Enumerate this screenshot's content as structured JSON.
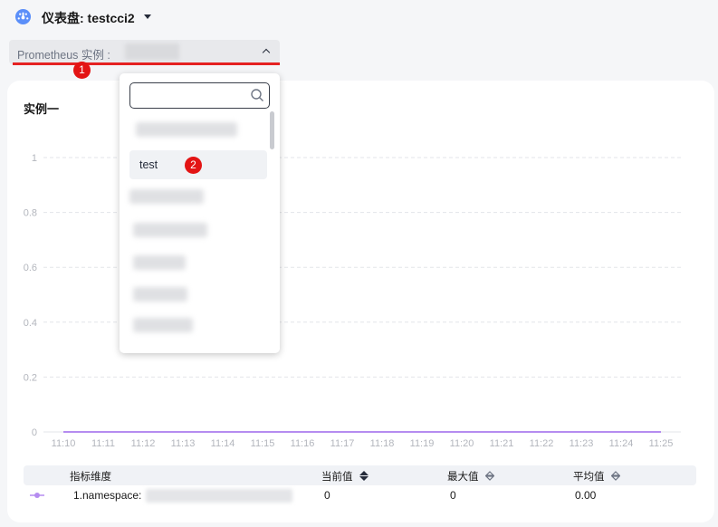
{
  "header": {
    "title": "仪表盘: testcci2"
  },
  "instance_select": {
    "label": "Prometheus 实例 :",
    "marker": "1"
  },
  "card": {
    "title": "实例一"
  },
  "dropdown": {
    "search_placeholder": "",
    "options": [
      {
        "label": "",
        "redacted": true
      },
      {
        "label": "test",
        "redacted": false,
        "marker": "2"
      },
      {
        "label": "",
        "redacted": true
      },
      {
        "label": "",
        "redacted": true
      },
      {
        "label": "",
        "redacted": true
      },
      {
        "label": "",
        "redacted": true
      },
      {
        "label": "",
        "redacted": true
      }
    ]
  },
  "chart_data": {
    "type": "line",
    "x": [
      "11:10",
      "11:11",
      "11:12",
      "11:13",
      "11:14",
      "11:15",
      "11:16",
      "11:17",
      "11:18",
      "11:19",
      "11:20",
      "11:21",
      "11:22",
      "11:23",
      "11:24",
      "11:25"
    ],
    "yticks": [
      "0",
      "0.2",
      "0.4",
      "0.6",
      "0.8",
      "1"
    ],
    "ylim": [
      0,
      1
    ],
    "grid": true,
    "series": [
      {
        "values": [
          0,
          0,
          0,
          0,
          0,
          0,
          0,
          0,
          0,
          0,
          0,
          0,
          0,
          0,
          0,
          0
        ],
        "color": "#b58cf0"
      }
    ]
  },
  "table": {
    "headers": {
      "dimension": "指标维度",
      "current": "当前值",
      "max": "最大值",
      "avg": "平均值"
    },
    "rows": [
      {
        "dimension": "1.namespace:",
        "current": "0",
        "max": "0",
        "avg": "0.00"
      }
    ]
  },
  "colors": {
    "accent": "#b58cf0",
    "marker": "#e31414",
    "underline": "#e52222"
  }
}
